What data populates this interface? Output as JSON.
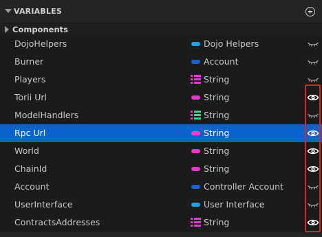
{
  "panel": {
    "title": "VARIABLES",
    "section": "Components"
  },
  "variables": [
    {
      "name": "DojoHelpers",
      "type": "Dojo Helpers",
      "type_icon": "pill",
      "type_color": "#1aa3e6",
      "visible": false,
      "selected": false
    },
    {
      "name": "Burner",
      "type": "Account",
      "type_icon": "pill",
      "type_color": "#1560d4",
      "visible": false,
      "selected": false
    },
    {
      "name": "Players",
      "type": "String",
      "type_icon": "array",
      "type_color": "#e23ad1",
      "visible": false,
      "selected": false
    },
    {
      "name": "Torii Url",
      "type": "String",
      "type_icon": "pill",
      "type_color": "#e23ad1",
      "visible": true,
      "selected": false
    },
    {
      "name": "ModelHandlers",
      "type": "String",
      "type_icon": "map",
      "type_color": "#e23ad1",
      "visible": false,
      "selected": false
    },
    {
      "name": "Rpc Url",
      "type": "String",
      "type_icon": "pill",
      "type_color": "#ff3ad8",
      "visible": true,
      "selected": true
    },
    {
      "name": "World",
      "type": "String",
      "type_icon": "pill",
      "type_color": "#e23ad1",
      "visible": true,
      "selected": false
    },
    {
      "name": "ChainId",
      "type": "String",
      "type_icon": "pill",
      "type_color": "#e23ad1",
      "visible": true,
      "selected": false
    },
    {
      "name": "Account",
      "type": "Controller Account",
      "type_icon": "pill",
      "type_color": "#1560d4",
      "visible": false,
      "selected": false
    },
    {
      "name": "UserInterface",
      "type": "User Interface",
      "type_icon": "pill",
      "type_color": "#1aa3e6",
      "visible": false,
      "selected": false
    },
    {
      "name": "ContractsAddresses",
      "type": "String",
      "type_icon": "array",
      "type_color": "#e23ad1",
      "visible": true,
      "selected": false
    }
  ],
  "icons": {
    "header_expand": "caret-down-icon",
    "section_expand": "caret-right-icon",
    "add": "add-circle-icon",
    "visible": "eye-open-icon",
    "hidden": "eye-closed-icon"
  },
  "colors": {
    "selection": "#0b63cf",
    "highlight_box": "#e0231f"
  }
}
